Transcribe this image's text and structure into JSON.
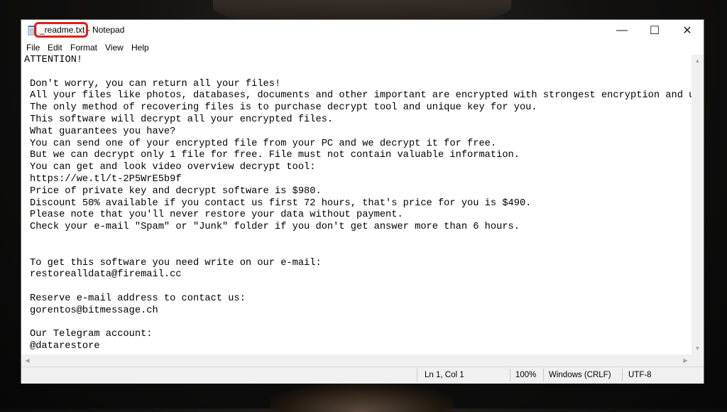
{
  "window": {
    "file_name": "_readme.txt",
    "title_suffix": " - Notepad",
    "controls": {
      "minimize": "—",
      "maximize": "☐",
      "close": "✕"
    }
  },
  "menu": [
    "File",
    "Edit",
    "Format",
    "View",
    "Help"
  ],
  "lines": [
    "ATTENTION!",
    "",
    "Don't worry, you can return all your files!",
    "All your files like photos, databases, documents and other important are encrypted with strongest encryption and unique key.",
    "The only method of recovering files is to purchase decrypt tool and unique key for you.",
    "This software will decrypt all your encrypted files.",
    "What guarantees you have?",
    "You can send one of your encrypted file from your PC and we decrypt it for free.",
    "But we can decrypt only 1 file for free. File must not contain valuable information.",
    "You can get and look video overview decrypt tool:",
    "https://we.tl/t-2P5WrE5b9f",
    "Price of private key and decrypt software is $980.",
    "Discount 50% available if you contact us first 72 hours, that's price for you is $490.",
    "Please note that you'll never restore your data without payment.",
    "Check your e-mail \"Spam\" or \"Junk\" folder if you don't get answer more than 6 hours.",
    "",
    "",
    "To get this software you need write on our e-mail:",
    "restorealldata@firemail.cc",
    "",
    "Reserve e-mail address to contact us:",
    "gorentos@bitmessage.ch",
    "",
    "Our Telegram account:",
    "@datarestore"
  ],
  "status": {
    "position": "Ln 1, Col 1",
    "zoom": "100%",
    "line_ending": "Windows (CRLF)",
    "encoding": "UTF-8"
  },
  "icons": {
    "app": "notepad-icon",
    "scroll_up": "chevron-up-icon",
    "scroll_down": "chevron-down-icon",
    "scroll_left": "chevron-left-icon",
    "scroll_right": "chevron-right-icon"
  },
  "colors": {
    "highlight": "#e0201b",
    "status_bg": "#f0f0f0"
  }
}
